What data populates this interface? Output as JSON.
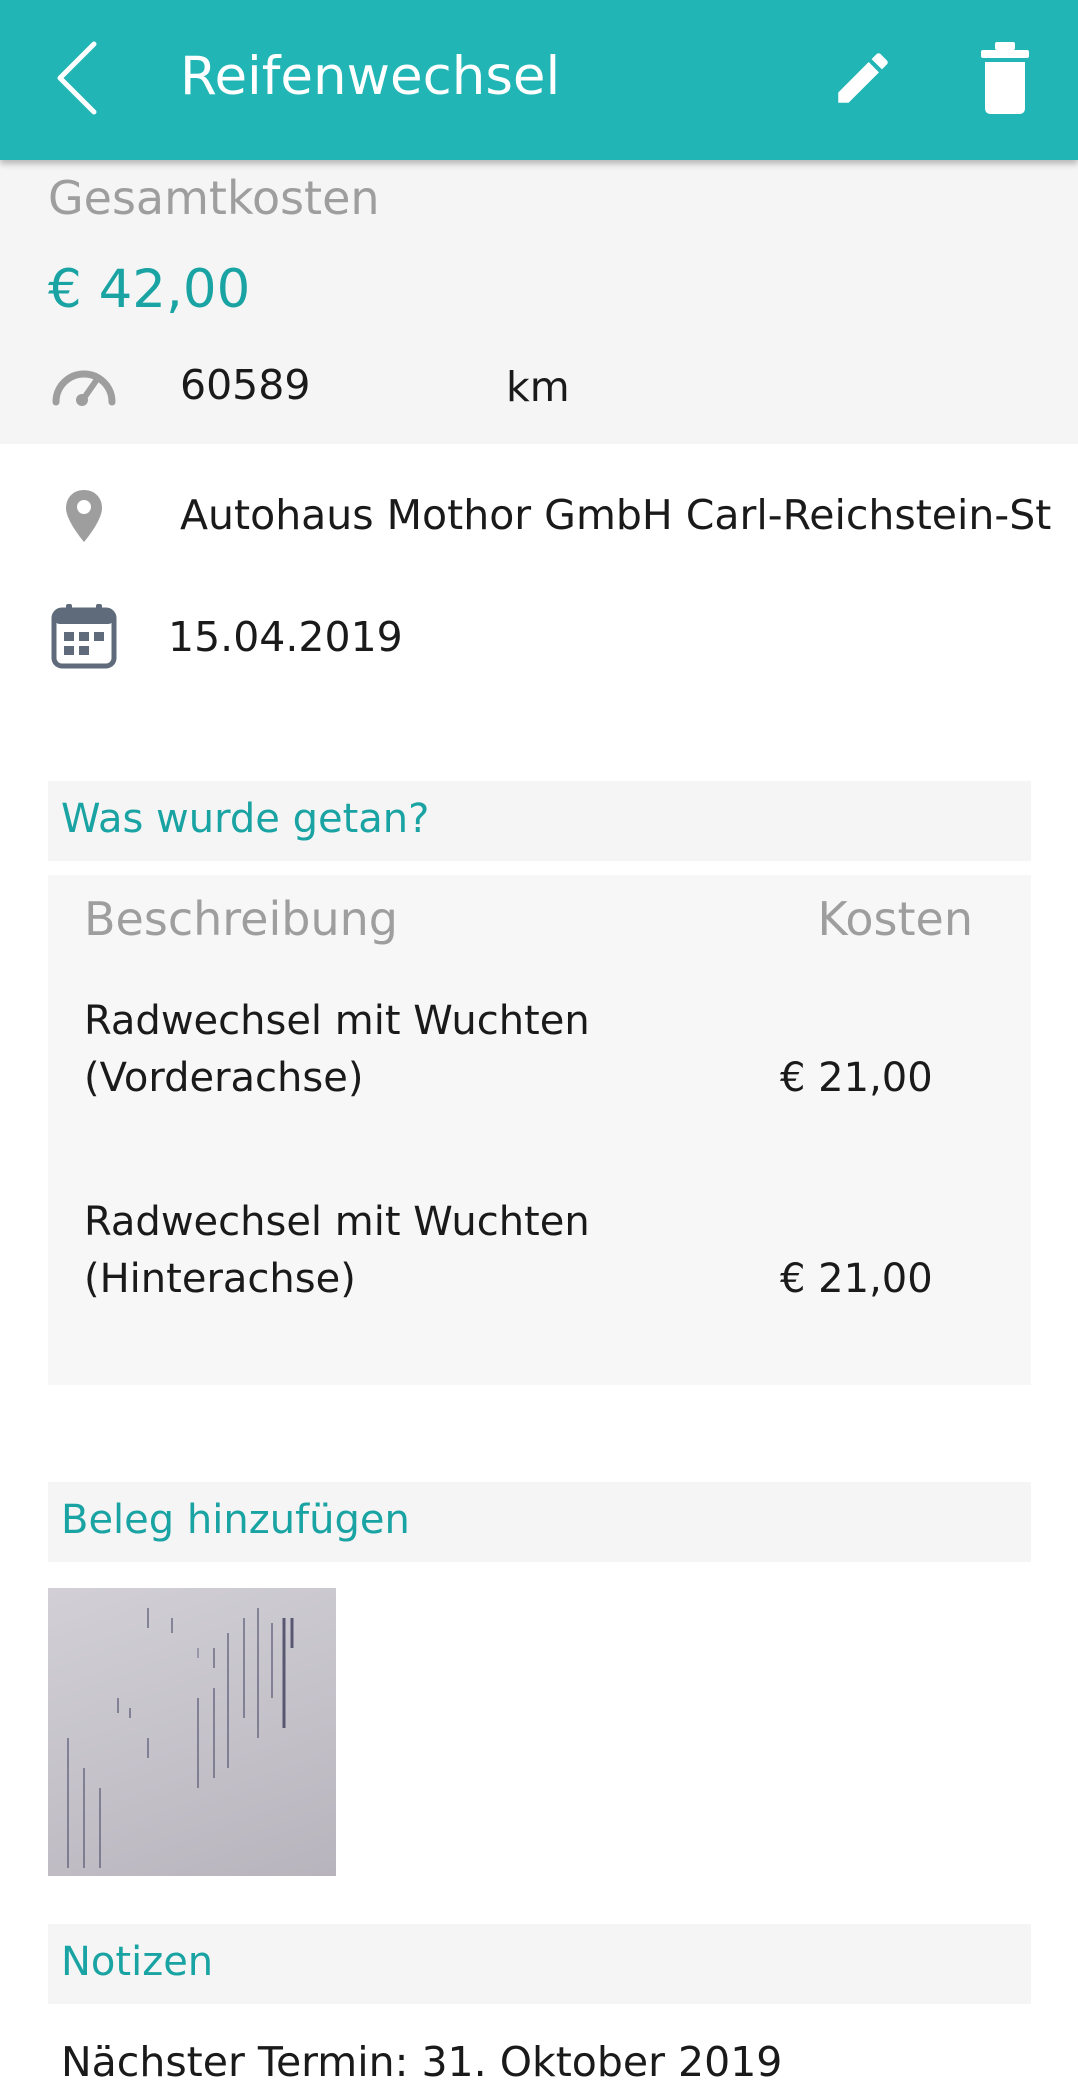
{
  "appbar": {
    "title": "Reifenwechsel",
    "back_icon": "chevron-left-icon",
    "edit_icon": "pencil-icon",
    "delete_icon": "trash-icon",
    "background": "#21b5b5"
  },
  "summary": {
    "total_label": "Gesamtkosten",
    "total_value": "€ 42,00",
    "odometer_icon": "speedometer-icon",
    "odometer_value": "60589",
    "odometer_unit": "km"
  },
  "details": {
    "location_icon": "map-pin-icon",
    "location": "Autohaus Mothor GmbH Carl-Reichstein-St",
    "date_icon": "calendar-icon",
    "date": "15.04.2019"
  },
  "work": {
    "heading": "Was wurde getan?",
    "col_description": "Beschreibung",
    "col_cost": "Kosten",
    "items": [
      {
        "description": "Radwechsel mit Wuchten (Vorderachse)",
        "cost": "€ 21,00"
      },
      {
        "description": "Radwechsel mit Wuchten (Hinterachse)",
        "cost": "€ 21,00"
      }
    ]
  },
  "receipt": {
    "heading": "Beleg hinzufügen"
  },
  "notes": {
    "heading": "Notizen",
    "text": "Nächster Termin: 31. Oktober 2019"
  },
  "colors": {
    "accent": "#1aa3a3",
    "muted": "#9e9e9e",
    "panel": "#f5f5f5"
  }
}
